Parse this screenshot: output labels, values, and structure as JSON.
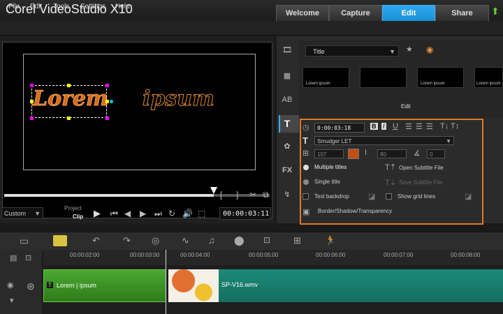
{
  "app": {
    "logo": "Corel VideoStudio X10"
  },
  "workspace_tabs": [
    "Welcome",
    "Capture",
    "Edit",
    "Share"
  ],
  "menu": [
    "File",
    "Edit",
    "Tools",
    "Settings",
    "Help"
  ],
  "preview": {
    "title_words": [
      "Lorem",
      "ipsum"
    ],
    "mode_label": "Project",
    "mode_value": "Clip",
    "preset": "Custom",
    "timecode": "00:00:03:11",
    "scrub_progress": 0.79
  },
  "library": {
    "category": "Title",
    "thumbs": [
      "Lorem ipsum",
      "",
      "Lorem ipsum",
      "Lorem ipsum"
    ],
    "edit_label": "Edit"
  },
  "options": {
    "duration": "0:00:03:18",
    "font": "Smudger LET",
    "size": "107",
    "line_spacing": "80",
    "angle": "0",
    "multiple_titles": "Multiple titles",
    "single_title": "Single title",
    "open_subtitle": "Open Subtitle File",
    "save_subtitle": "Save Subtitle File",
    "text_backdrop": "Text backdrop",
    "show_grid": "Show grid lines",
    "border_shadow": "Border/Shadow/Transparency",
    "text_color": "#c24e14",
    "highlight_color": "#e07a28"
  },
  "timeline": {
    "ticks": [
      "00:00:02:00",
      "00:00:03:00",
      "00:00:04:00",
      "00:00:05:00",
      "00:00:06:00",
      "00:00:07:00",
      "00:00:08:00"
    ],
    "title_clip": "Lorem | ipsum",
    "video_clip": "SP-V16.wmv"
  }
}
